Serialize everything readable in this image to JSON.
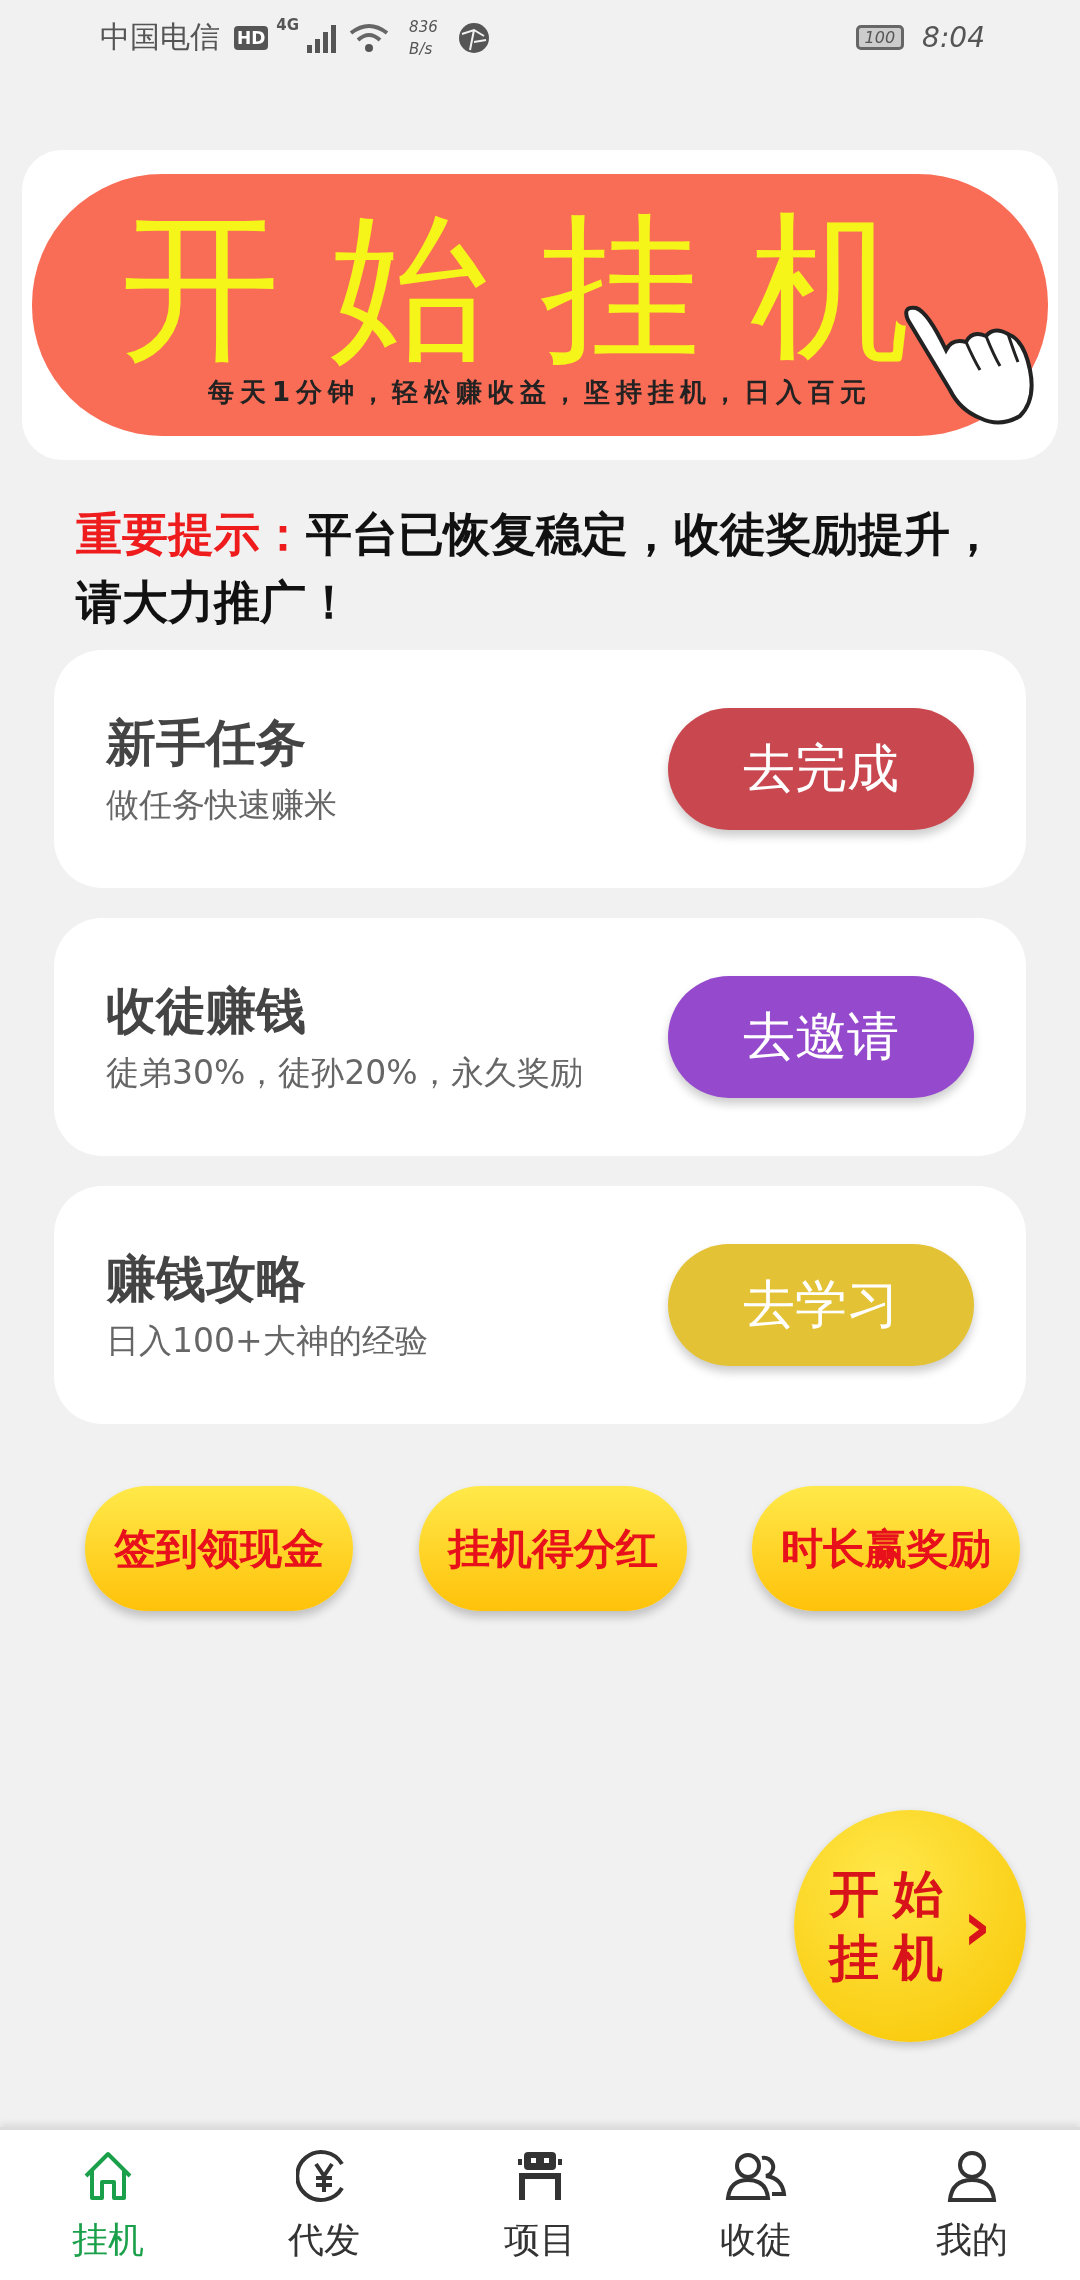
{
  "status_bar": {
    "carrier": "中国电信",
    "hd_badge": "HD",
    "network": "4G",
    "speed_value": "836",
    "speed_unit": "B/s",
    "battery": "100",
    "time": "8:04"
  },
  "banner": {
    "title": "开始挂机",
    "subtitle": "每天1分钟，轻松赚收益，坚持挂机，日入百元"
  },
  "notice": {
    "label": "重要提示：",
    "text": "平台已恢复稳定，收徒奖励提升，请大力推广！"
  },
  "tasks": [
    {
      "title": "新手任务",
      "subtitle": "做任务快速赚米",
      "button": "去完成",
      "color": "#c9474f"
    },
    {
      "title": "收徒赚钱",
      "subtitle": "徒弟30%，徒孙20%，永久奖励",
      "button": "去邀请",
      "color": "#9549cc"
    },
    {
      "title": "赚钱攻略",
      "subtitle": "日入100+大神的经验",
      "button": "去学习",
      "color": "#e4c236"
    }
  ],
  "quick_buttons": [
    "签到领现金",
    "挂机得分红",
    "时长赢奖励"
  ],
  "float_button": {
    "line_1": "开始",
    "line_2": "挂机",
    "arrow": "›"
  },
  "nav": [
    {
      "label": "挂机",
      "kind": "home",
      "selected": true
    },
    {
      "label": "代发",
      "kind": "yuan",
      "selected": false
    },
    {
      "label": "项目",
      "kind": "robot",
      "selected": false
    },
    {
      "label": "收徒",
      "kind": "people",
      "selected": false
    },
    {
      "label": "我的",
      "kind": "person",
      "selected": false
    }
  ]
}
